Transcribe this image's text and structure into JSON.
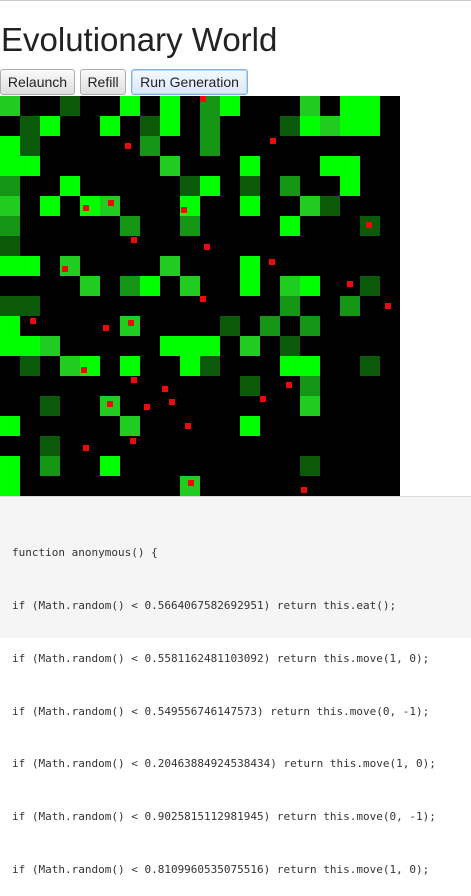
{
  "page": {
    "title": "Evolutionary World"
  },
  "toolbar": {
    "relaunch_label": "Relaunch",
    "refill_label": "Refill",
    "run_generation_label": "Run Generation"
  },
  "world": {
    "description_colors": {
      "empty": "#000000",
      "food_bright": "#00ff00",
      "food_dim": "#1fcc1f",
      "food_medium": "#149614",
      "food_dark": "#0a5a0a",
      "agent": "#ee0a0a"
    },
    "grid_rows": [
      "3001003030230003033x",
      "0130030130200013333x",
      "3100000200200000000x",
      "3300000030003000330x",
      "2003000001301020030x",
      "3030330003003003100x",
      "2000002002000030001x",
      "1000000000000000000x",
      "3303000030003000000x",
      "0000302303003033001x",
      "1100000000000020020x",
      "3000003000010202000x",
      "3330000033303010000x",
      "0103303003100033001x",
      "0000000000001002000x",
      "0010030000000003000x",
      "3000003000003000000x",
      "0010000000000000000x",
      "3020030000000001000x",
      "3000000003000000000x"
    ],
    "agents": [
      {
        "col": 10,
        "row": 0
      },
      {
        "col": 6,
        "row": 2
      },
      {
        "col": 13,
        "row": 2
      },
      {
        "col": 4,
        "row": 5
      },
      {
        "col": 5,
        "row": 5
      },
      {
        "col": 9,
        "row": 5
      },
      {
        "col": 18,
        "row": 6
      },
      {
        "col": 6,
        "row": 7
      },
      {
        "col": 10,
        "row": 7
      },
      {
        "col": 13,
        "row": 8
      },
      {
        "col": 3,
        "row": 8
      },
      {
        "col": 17,
        "row": 9
      },
      {
        "col": 10,
        "row": 10
      },
      {
        "col": 19,
        "row": 10
      },
      {
        "col": 1,
        "row": 11
      },
      {
        "col": 5,
        "row": 11
      },
      {
        "col": 6,
        "row": 11
      },
      {
        "col": 4,
        "row": 13
      },
      {
        "col": 14,
        "row": 14
      },
      {
        "col": 6,
        "row": 14
      },
      {
        "col": 7,
        "row": 15
      },
      {
        "col": 8,
        "row": 15
      },
      {
        "col": 8,
        "row": 14
      },
      {
        "col": 5,
        "row": 15
      },
      {
        "col": 13,
        "row": 15
      },
      {
        "col": 9,
        "row": 16
      },
      {
        "col": 6,
        "row": 17
      },
      {
        "col": 4,
        "row": 17
      },
      {
        "col": 9,
        "row": 19
      },
      {
        "col": 15,
        "row": 19
      }
    ]
  },
  "code": {
    "lines": [
      "function anonymous() {",
      "if (Math.random() < 0.5664067582692951) return this.eat();",
      "if (Math.random() < 0.5581162481103092) return this.move(1, 0);",
      "if (Math.random() < 0.549556746147573) return this.move(0, -1);",
      "if (Math.random() < 0.20463884924538434) return this.move(1, 0);",
      "if (Math.random() < 0.9025815112981945) return this.move(0, -1);",
      "if (Math.random() < 0.8109960535075516) return this.move(1, 0);"
    ]
  }
}
